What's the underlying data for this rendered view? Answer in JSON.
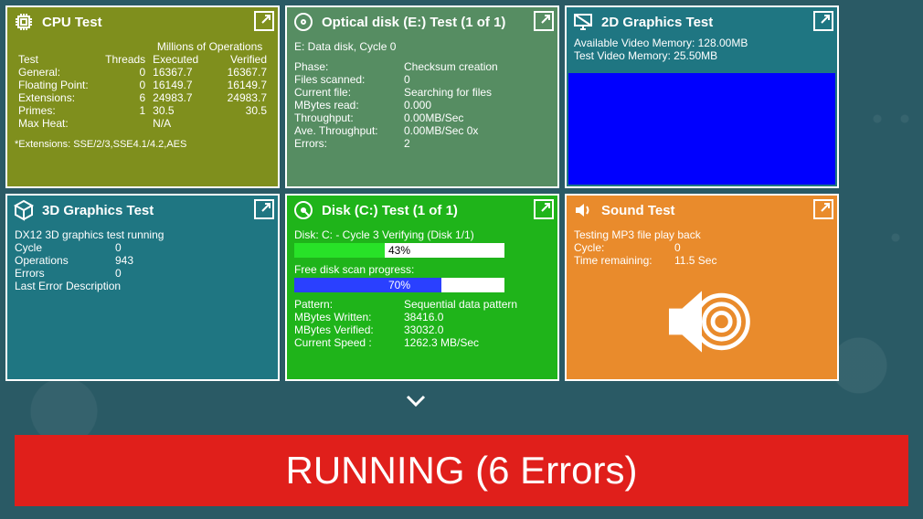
{
  "cpu": {
    "title": "CPU Test",
    "table_header": {
      "test": "Test",
      "threads": "Threads",
      "executed_super": "Millions of Operations",
      "executed": "Executed",
      "verified": "Verified"
    },
    "rows": [
      {
        "name": "General:",
        "threads": "0",
        "exec": "16367.7",
        "ver": "16367.7"
      },
      {
        "name": "Floating Point:",
        "threads": "0",
        "exec": "16149.7",
        "ver": "16149.7"
      },
      {
        "name": "Extensions:",
        "threads": "6",
        "exec": "24983.7",
        "ver": "24983.7"
      },
      {
        "name": "Primes:",
        "threads": "1",
        "exec": "30.5",
        "ver": "30.5"
      },
      {
        "name": "Max Heat:",
        "threads": "",
        "exec": "N/A",
        "ver": ""
      }
    ],
    "footnote": "*Extensions: SSE/2/3,SSE4.1/4.2,AES"
  },
  "optical": {
    "title": "Optical disk (E:) Test (1 of 1)",
    "desc": "E: Data disk, Cycle 0",
    "rows": [
      {
        "k": "Phase:",
        "v": "Checksum creation"
      },
      {
        "k": "Files scanned:",
        "v": "0"
      },
      {
        "k": "Current file:",
        "v": "Searching for files"
      },
      {
        "k": "MBytes read:",
        "v": "0.000"
      },
      {
        "k": "Throughput:",
        "v": "0.00MB/Sec"
      },
      {
        "k": "Ave. Throughput:",
        "v": "0.00MB/Sec 0x"
      },
      {
        "k": "Errors:",
        "v": "2"
      }
    ]
  },
  "g2d": {
    "title": "2D Graphics Test",
    "line1": "Available Video Memory: 128.00MB",
    "line2": "Test Video Memory: 25.50MB"
  },
  "g3d": {
    "title": "3D Graphics Test",
    "desc": "DX12 3D graphics test running",
    "rows": [
      {
        "k": "Cycle",
        "v": "0"
      },
      {
        "k": "Operations",
        "v": "943"
      },
      {
        "k": "Errors",
        "v": "0"
      }
    ],
    "last_err_label": "Last Error Description"
  },
  "disk": {
    "title": "Disk (C:) Test (1 of 1)",
    "line1": "Disk: C: - Cycle 3 Verifying (Disk 1/1)",
    "progress1_pct": 43,
    "progress1_label": "43%",
    "free_label": "Free disk scan progress:",
    "progress2_pct": 70,
    "progress2_label": "70%",
    "rows": [
      {
        "k": "Pattern:",
        "v": "Sequential data pattern"
      },
      {
        "k": "MBytes Written:",
        "v": "38416.0"
      },
      {
        "k": "MBytes Verified:",
        "v": "33032.0"
      },
      {
        "k": "Current Speed :",
        "v": "1262.3 MB/Sec"
      }
    ]
  },
  "sound": {
    "title": "Sound Test",
    "desc": "Testing MP3 file play back",
    "rows": [
      {
        "k": "Cycle:",
        "v": "0"
      },
      {
        "k": "Time remaining:",
        "v": "11.5 Sec"
      }
    ]
  },
  "status_text": "RUNNING (6 Errors)"
}
